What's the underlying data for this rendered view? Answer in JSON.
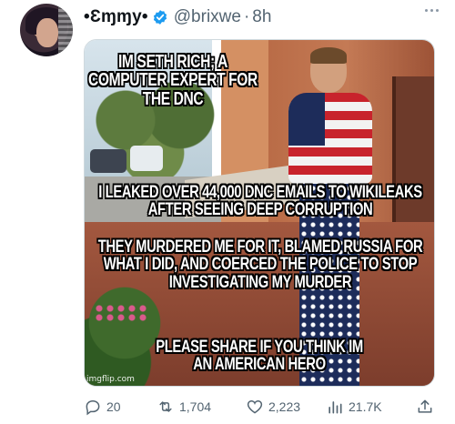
{
  "tweet": {
    "display_name": "•Ɛɱɱy•",
    "handle": "@brixwe",
    "separator": "·",
    "timestamp": "8h",
    "verified_icon": "verified-badge-icon",
    "more_icon": "more-options-icon",
    "accent_color": "#1d9bf0",
    "secondary_text_color": "#536471"
  },
  "media": {
    "text_top": "IM SETH RICH; A COMPUTER EXPERT FOR THE DNC",
    "text_middle": "I LEAKED OVER 44,000 DNC EMAILS TO WIKILEAKS AFTER SEEING DEEP CORRUPTION",
    "text_lower": "THEY MURDERED ME FOR IT, BLAMED RUSSIA FOR WHAT I DID, AND COERCED THE POLICE TO STOP INVESTIGATING MY MURDER",
    "text_bottom": "PLEASE SHARE IF YOU THINK IM AN AMERICAN HERO",
    "watermark": "imgflip.com"
  },
  "actions": {
    "replies": "20",
    "retweets": "1,704",
    "likes": "2,223",
    "views": "21.7K"
  }
}
